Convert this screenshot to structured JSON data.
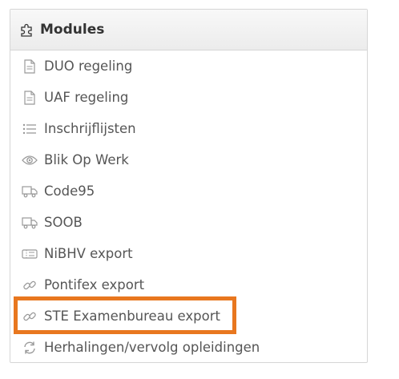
{
  "panel": {
    "title": "Modules",
    "header_icon": "puzzle-icon"
  },
  "modules": [
    {
      "label": "DUO regeling",
      "icon": "document-icon"
    },
    {
      "label": "UAF regeling",
      "icon": "document-icon"
    },
    {
      "label": "Inschrijflijsten",
      "icon": "list-icon"
    },
    {
      "label": "Blik Op Werk",
      "icon": "eye-icon"
    },
    {
      "label": "Code95",
      "icon": "truck-icon"
    },
    {
      "label": "SOOB",
      "icon": "truck-icon"
    },
    {
      "label": "NiBHV export",
      "icon": "ticket-icon"
    },
    {
      "label": "Pontifex export",
      "icon": "link-icon"
    },
    {
      "label": "STE Examenbureau export",
      "icon": "link-icon"
    },
    {
      "label": "Herhalingen/vervolg opleidingen",
      "icon": "refresh-icon"
    }
  ],
  "highlight": {
    "color": "#e8771f",
    "target": "STE Examenbureau export"
  }
}
